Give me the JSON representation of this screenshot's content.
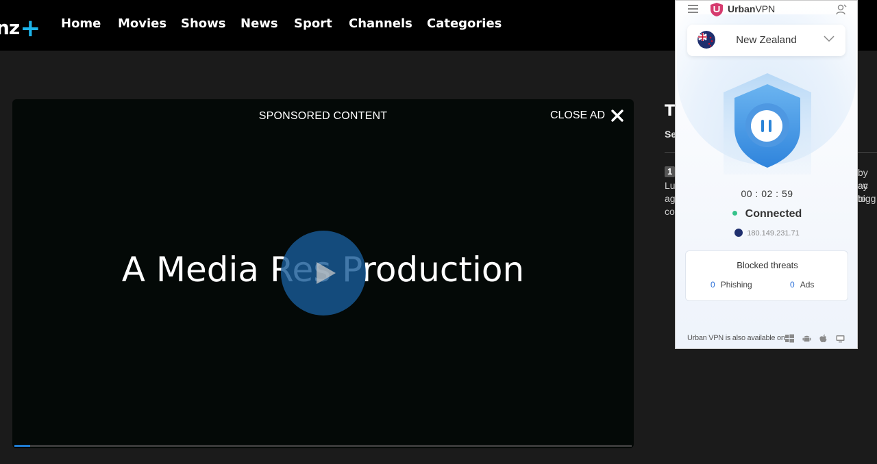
{
  "nav": {
    "logo_text": "nz",
    "logo_plus": "+",
    "items": [
      "Home",
      "Movies",
      "Shows",
      "News",
      "Sport",
      "Channels",
      "Categories"
    ]
  },
  "player": {
    "sponsored_label": "SPONSORED CONTENT",
    "close_label": "CLOSE AD",
    "headline": "A Media Res Production",
    "progress_fraction": 0.025,
    "accent": "#1f7bd1"
  },
  "side": {
    "title_fragment": "T",
    "sub_fragment": "Se",
    "badge_fragment": "1",
    "text_lines_left": [
      "Lu",
      "ag",
      "co"
    ],
    "text_lines_right": [
      "by ac",
      "ay to",
      "bigg"
    ]
  },
  "vpn": {
    "brand_bold": "Urban",
    "brand_rest": "VPN",
    "country": "New Zealand",
    "timer": "00 : 02 : 59",
    "status": "Connected",
    "status_color": "#35c28a",
    "ip": "180.149.231.71",
    "threats": {
      "title": "Blocked threats",
      "phishing_count": "0",
      "phishing_label": "Phishing",
      "ads_count": "0",
      "ads_label": "Ads"
    },
    "footer": "Urban VPN is also available on",
    "os_icons": [
      "windows-icon",
      "android-icon",
      "apple-icon",
      "desktop-icon"
    ]
  }
}
